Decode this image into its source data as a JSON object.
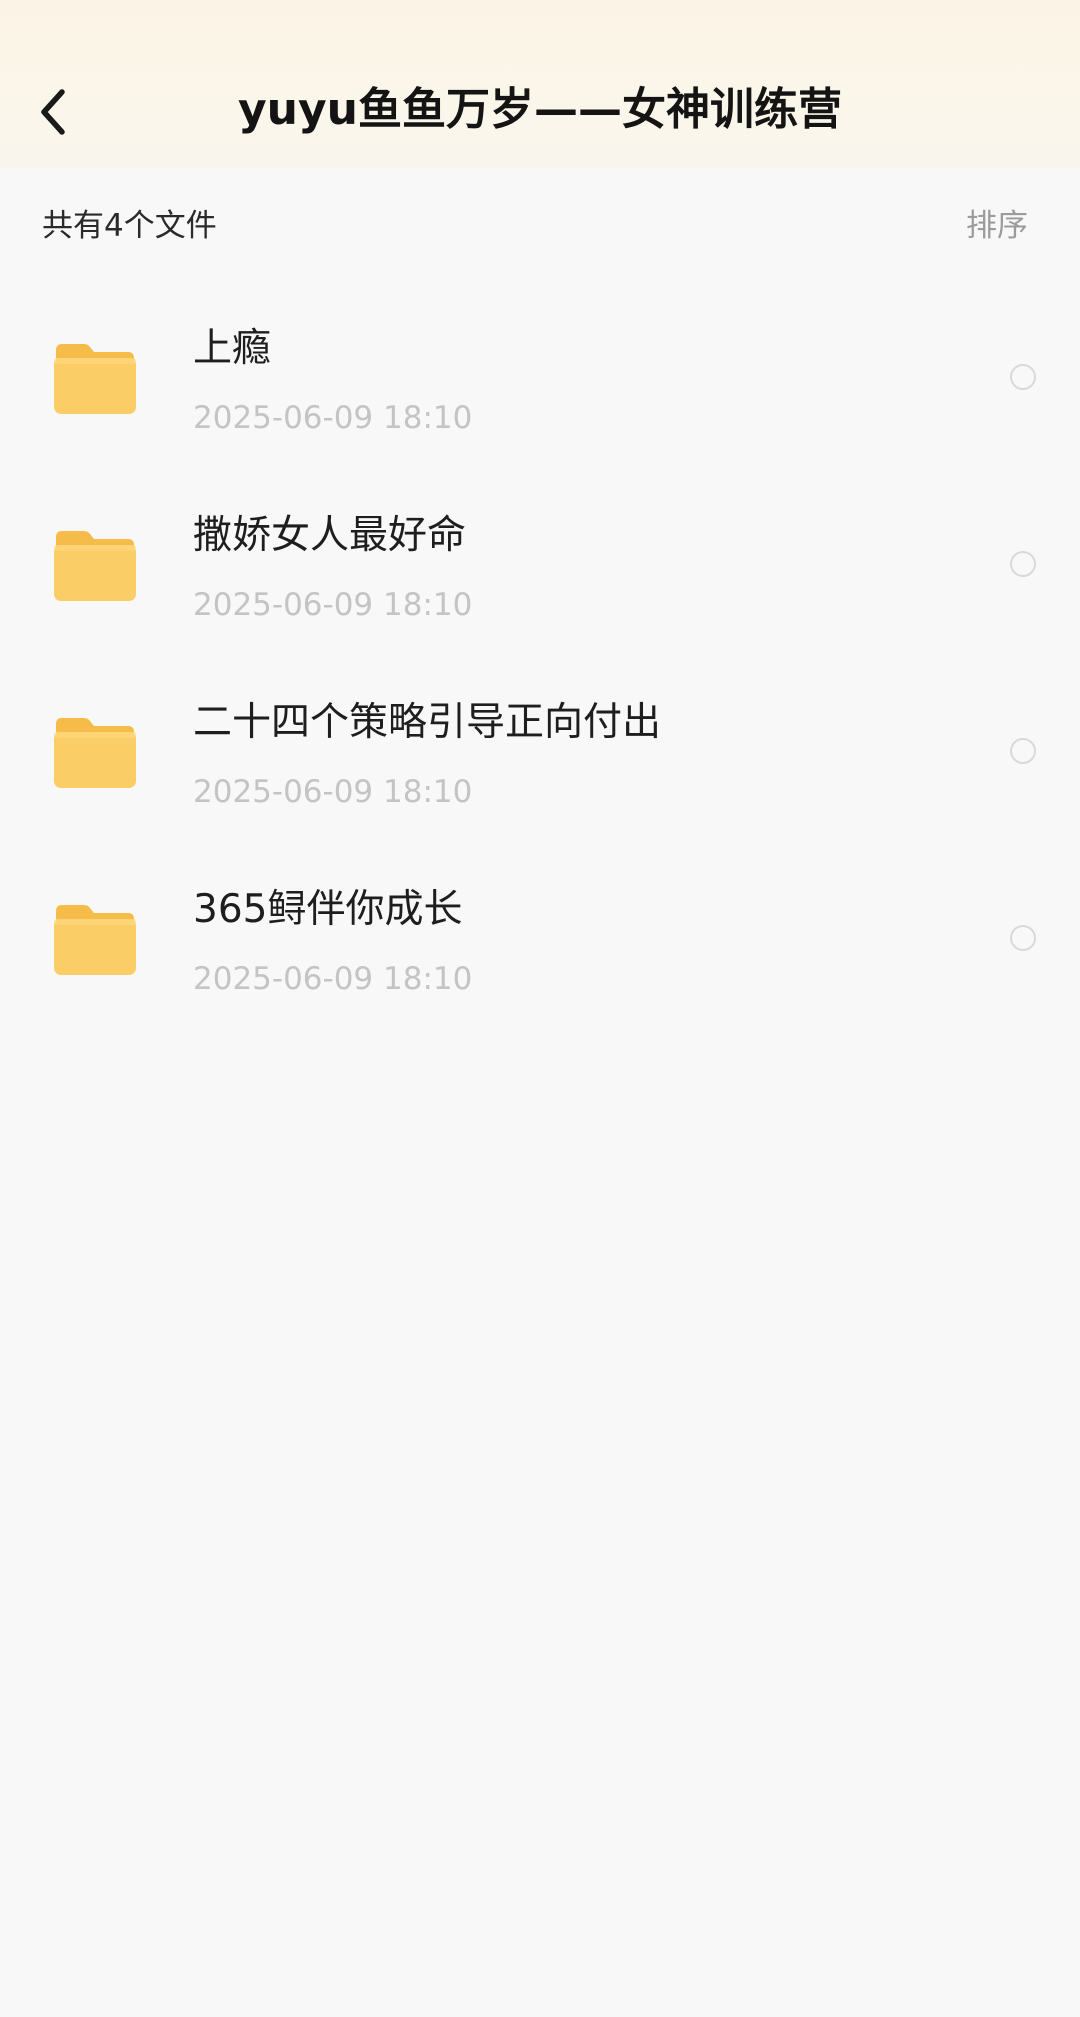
{
  "header": {
    "title": "yuyu鱼鱼万岁——女神训练营",
    "back_icon": "chevron-left-icon"
  },
  "toolbar": {
    "file_count": "共有4个文件",
    "sort_label": "排序"
  },
  "files": [
    {
      "name": "上瘾",
      "date": "2025-06-09 18:10",
      "icon": "folder-icon"
    },
    {
      "name": "撒娇女人最好命",
      "date": "2025-06-09 18:10",
      "icon": "folder-icon"
    },
    {
      "name": "二十四个策略引导正向付出",
      "date": "2025-06-09 18:10",
      "icon": "folder-icon"
    },
    {
      "name": "365鲟伴你成长",
      "date": "2025-06-09 18:10",
      "icon": "folder-icon"
    }
  ],
  "colors": {
    "header_bg": "#fbf4e6",
    "folder_yellow": "#fbcd66",
    "folder_back": "#f6bc4a",
    "date_gray": "#c4c4c4"
  }
}
